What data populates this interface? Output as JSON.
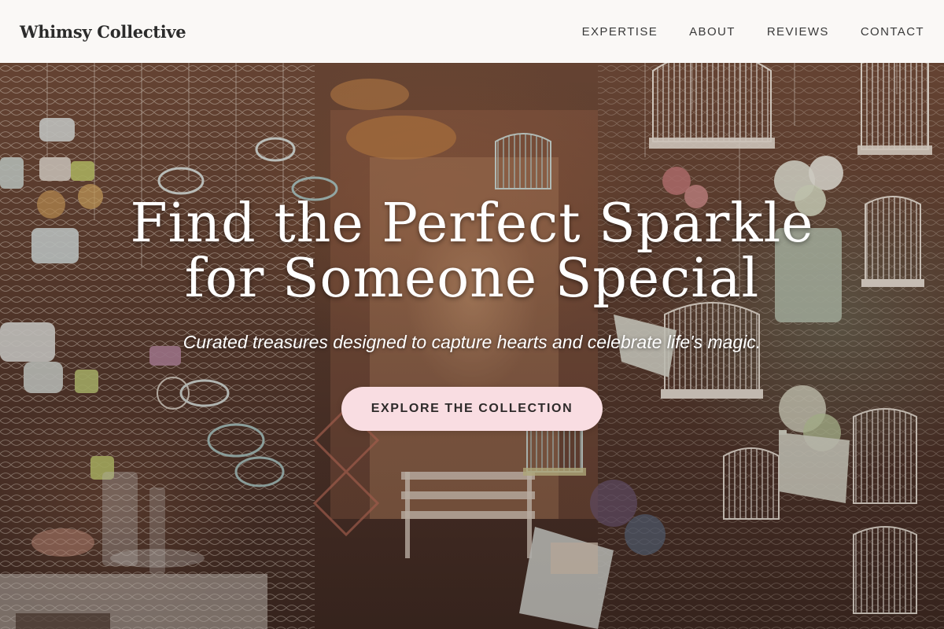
{
  "header": {
    "brand": "Whimsy Collective",
    "nav": [
      "EXPERTISE",
      "ABOUT",
      "REVIEWS",
      "CONTACT"
    ]
  },
  "hero": {
    "headline_line1": "Find the Perfect Sparkle",
    "headline_line2": "for Someone Special",
    "subtitle": "Curated treasures designed to capture hearts and celebrate life's magic.",
    "cta_label": "EXPLORE THE COLLECTION",
    "background_image": "gift shop interior with hanging white birdcages, teacups, watering cans and flowers"
  },
  "colors": {
    "header_bg": "#faf8f6",
    "brand_text": "#2b2b2b",
    "nav_text": "#3a3a3a",
    "headline_text": "#ffffff",
    "cta_bg": "#f9dde2",
    "cta_text": "#2e2a2a"
  }
}
